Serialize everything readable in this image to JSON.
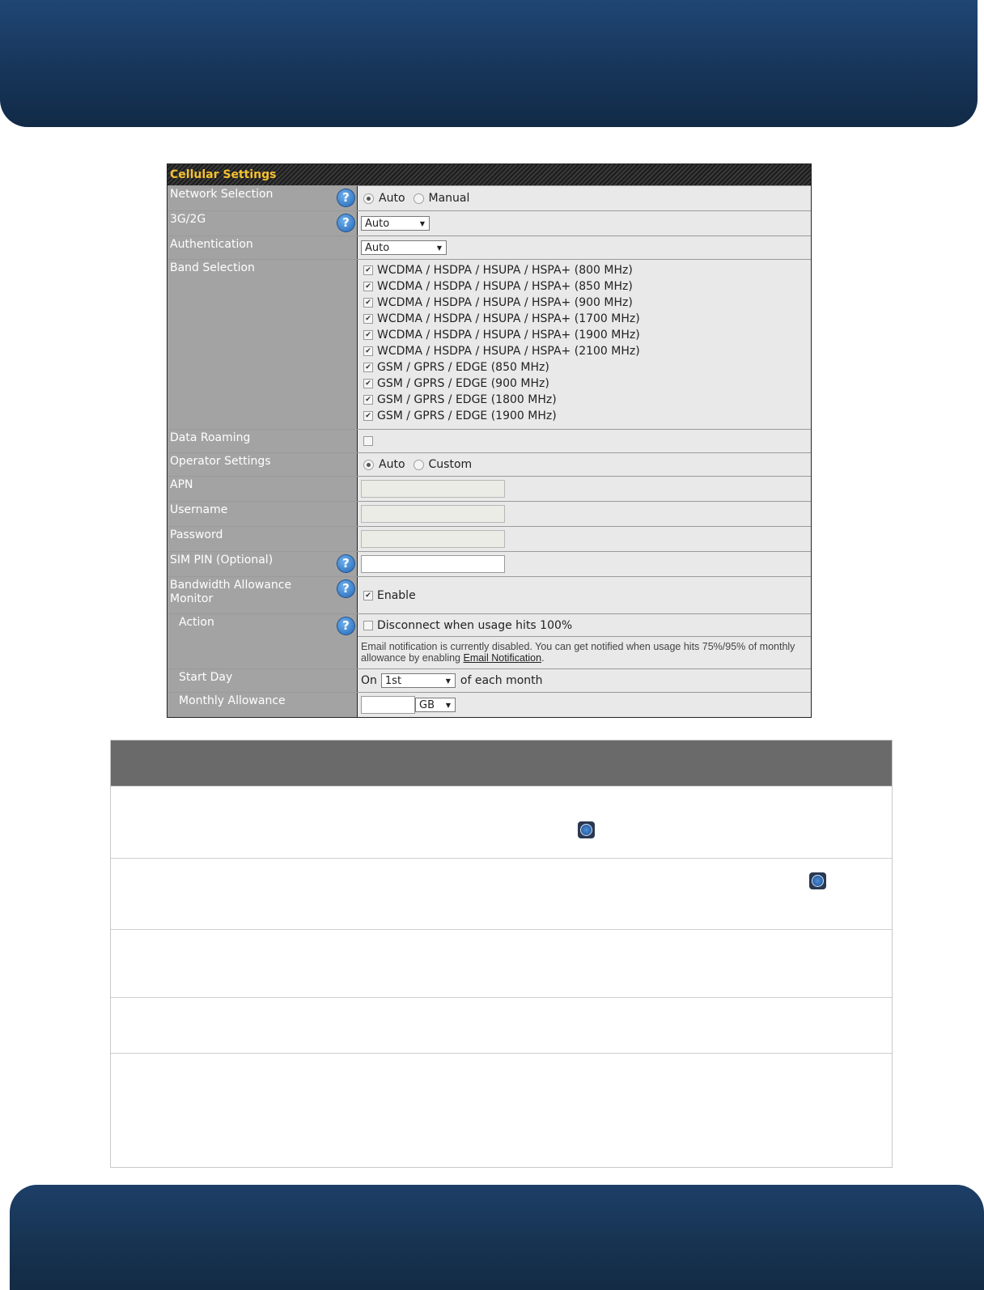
{
  "panel": {
    "title": "Cellular Settings",
    "network_selection": {
      "label": "Network Selection",
      "options": [
        "Auto",
        "Manual"
      ],
      "selected": "Auto"
    },
    "mode": {
      "label": "3G/2G",
      "value": "Auto"
    },
    "authentication": {
      "label": "Authentication",
      "value": "Auto"
    },
    "band_selection": {
      "label": "Band Selection",
      "bands": [
        "WCDMA / HSDPA / HSUPA / HSPA+ (800 MHz)",
        "WCDMA / HSDPA / HSUPA / HSPA+ (850 MHz)",
        "WCDMA / HSDPA / HSUPA / HSPA+ (900 MHz)",
        "WCDMA / HSDPA / HSUPA / HSPA+ (1700 MHz)",
        "WCDMA / HSDPA / HSUPA / HSPA+ (1900 MHz)",
        "WCDMA / HSDPA / HSUPA / HSPA+ (2100 MHz)",
        "GSM / GPRS / EDGE (850 MHz)",
        "GSM / GPRS / EDGE (900 MHz)",
        "GSM / GPRS / EDGE (1800 MHz)",
        "GSM / GPRS / EDGE (1900 MHz)"
      ]
    },
    "data_roaming": {
      "label": "Data Roaming"
    },
    "operator_settings": {
      "label": "Operator Settings",
      "options": [
        "Auto",
        "Custom"
      ],
      "selected": "Auto"
    },
    "apn": {
      "label": "APN"
    },
    "username": {
      "label": "Username"
    },
    "password": {
      "label": "Password"
    },
    "sim_pin": {
      "label": "SIM PIN (Optional)"
    },
    "bandwidth_monitor": {
      "label": "Bandwidth Allowance Monitor",
      "enable_label": "Enable"
    },
    "action": {
      "label": "Action",
      "disconnect_label": "Disconnect when usage hits 100%",
      "note_text": "Email notification is currently disabled. You can get notified when usage hits 75%/95% of monthly allowance by enabling ",
      "note_link": "Email Notification",
      "note_end": "."
    },
    "start_day": {
      "label": "Start Day",
      "prefix": "On",
      "value": "1st",
      "suffix": "of each month"
    },
    "monthly_allowance": {
      "label": "Monthly Allowance",
      "unit": "GB"
    }
  },
  "icons": {
    "help": "help-icon"
  }
}
